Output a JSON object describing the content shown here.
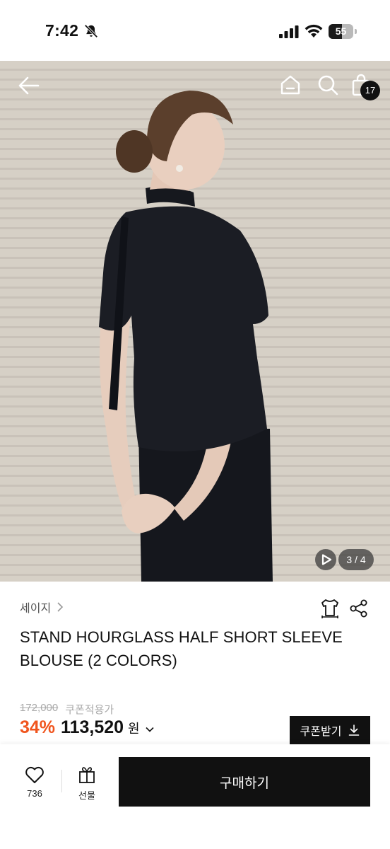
{
  "status_bar": {
    "time": "7:42",
    "battery": "55",
    "battery_level": 0.55,
    "icons": [
      "bell-off-icon",
      "signal-icon",
      "wifi-icon",
      "battery-icon"
    ]
  },
  "photo": {
    "counter": "3 / 4",
    "cart_count": "17",
    "icons": [
      "back-arrow-icon",
      "home-icon",
      "search-icon",
      "shopping-bag-icon",
      "play-icon"
    ]
  },
  "product": {
    "brand": "세이지",
    "title": "STAND HOURGLASS HALF SHORT SLEEVE BLOUSE (2 COLORS)",
    "original_price": "172,000",
    "coupon_note": "쿠폰적용가",
    "discount": "34%",
    "price": "113,520",
    "currency": "원",
    "coupon_button": "쿠폰받기",
    "icons": [
      "size-guide-icon",
      "share-icon",
      "chevron-down-icon",
      "download-icon"
    ]
  },
  "bottom_bar": {
    "like_count": "736",
    "gift_label": "선물",
    "buy_label": "구매하기",
    "icons": [
      "heart-icon",
      "gift-icon"
    ]
  },
  "colors": {
    "discount": "#f0551e",
    "button": "#111111",
    "photo_background": "#cfc8bd"
  }
}
